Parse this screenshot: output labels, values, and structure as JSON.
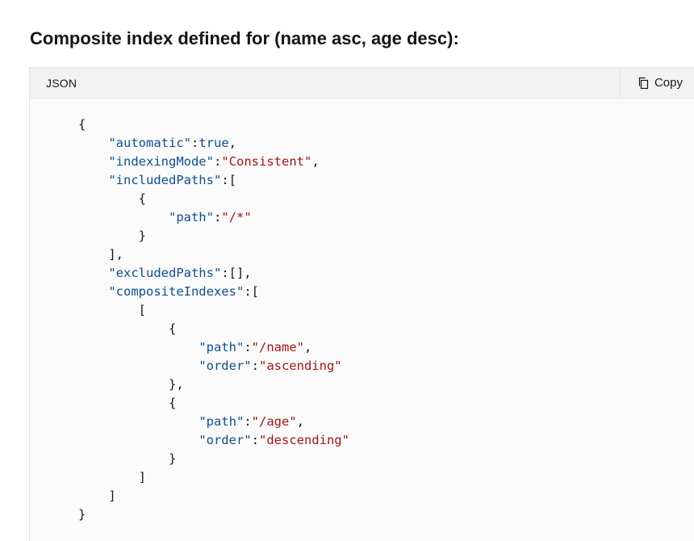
{
  "heading": "Composite index defined for (name asc, age desc):",
  "code_block": {
    "language_label": "JSON",
    "copy_label": "Copy",
    "lines": [
      [
        [
          "p",
          "{"
        ]
      ],
      [
        [
          "p",
          "    "
        ],
        [
          "k",
          "\"automatic\""
        ],
        [
          "p",
          ":"
        ],
        [
          "b",
          "true"
        ],
        [
          "p",
          ","
        ]
      ],
      [
        [
          "p",
          "    "
        ],
        [
          "k",
          "\"indexingMode\""
        ],
        [
          "p",
          ":"
        ],
        [
          "s",
          "\"Consistent\""
        ],
        [
          "p",
          ","
        ]
      ],
      [
        [
          "p",
          "    "
        ],
        [
          "k",
          "\"includedPaths\""
        ],
        [
          "p",
          ":["
        ]
      ],
      [
        [
          "p",
          "        {"
        ]
      ],
      [
        [
          "p",
          "            "
        ],
        [
          "k",
          "\"path\""
        ],
        [
          "p",
          ":"
        ],
        [
          "s",
          "\"/*\""
        ]
      ],
      [
        [
          "p",
          "        }"
        ]
      ],
      [
        [
          "p",
          "    ],"
        ]
      ],
      [
        [
          "p",
          "    "
        ],
        [
          "k",
          "\"excludedPaths\""
        ],
        [
          "p",
          ":[],"
        ]
      ],
      [
        [
          "p",
          "    "
        ],
        [
          "k",
          "\"compositeIndexes\""
        ],
        [
          "p",
          ":["
        ]
      ],
      [
        [
          "p",
          "        ["
        ]
      ],
      [
        [
          "p",
          "            {"
        ]
      ],
      [
        [
          "p",
          "                "
        ],
        [
          "k",
          "\"path\""
        ],
        [
          "p",
          ":"
        ],
        [
          "s",
          "\"/name\""
        ],
        [
          "p",
          ","
        ]
      ],
      [
        [
          "p",
          "                "
        ],
        [
          "k",
          "\"order\""
        ],
        [
          "p",
          ":"
        ],
        [
          "s",
          "\"ascending\""
        ]
      ],
      [
        [
          "p",
          "            },"
        ]
      ],
      [
        [
          "p",
          "            {"
        ]
      ],
      [
        [
          "p",
          "                "
        ],
        [
          "k",
          "\"path\""
        ],
        [
          "p",
          ":"
        ],
        [
          "s",
          "\"/age\""
        ],
        [
          "p",
          ","
        ]
      ],
      [
        [
          "p",
          "                "
        ],
        [
          "k",
          "\"order\""
        ],
        [
          "p",
          ":"
        ],
        [
          "s",
          "\"descending\""
        ]
      ],
      [
        [
          "p",
          "            }"
        ]
      ],
      [
        [
          "p",
          "        ]"
        ]
      ],
      [
        [
          "p",
          "    ]"
        ]
      ],
      [
        [
          "p",
          "}"
        ]
      ]
    ]
  },
  "icons": {
    "copy": "copy-icon"
  },
  "colors": {
    "key": "#0e4f8f",
    "string": "#a31515",
    "boolean": "#0e4f8f",
    "header_bg": "#f2f2f2",
    "code_bg": "#fafafa"
  }
}
